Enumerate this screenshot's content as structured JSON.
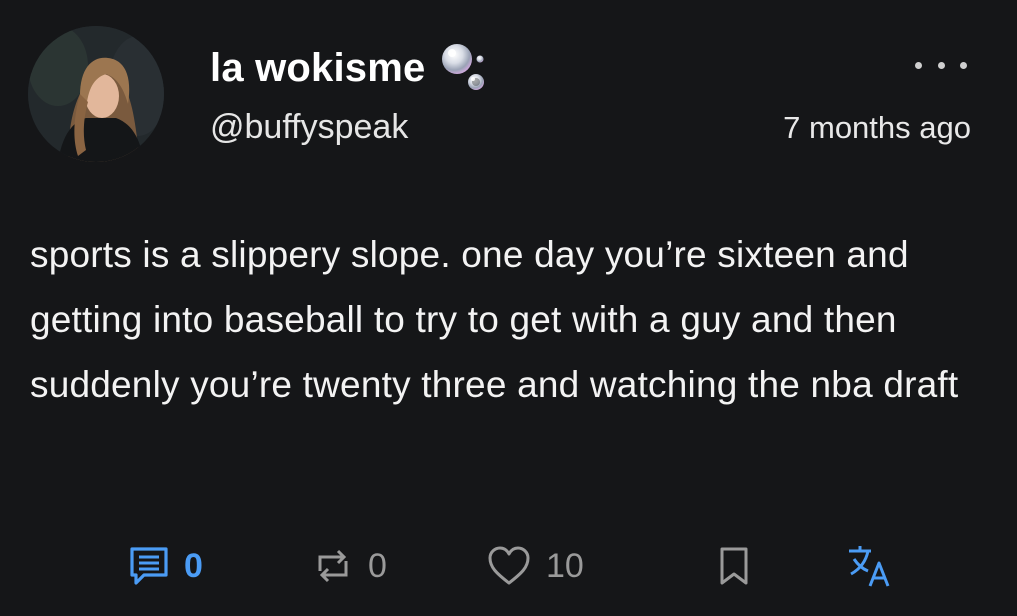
{
  "author": {
    "display_name": "la wokisme",
    "handle": "@buffyspeak",
    "badge_icon": "bubbles-icon"
  },
  "post": {
    "timestamp": "7 months ago",
    "body": "sports is a slippery slope. one day you’re sixteen and getting into baseball to try to get with a guy and then suddenly you’re twenty three and watching the nba draft"
  },
  "actions": {
    "replies": "0",
    "reposts": "0",
    "likes": "10"
  },
  "colors": {
    "background": "#151618",
    "accent": "#4b9cf5",
    "muted": "#9a9a9a",
    "text": "#ffffff"
  }
}
